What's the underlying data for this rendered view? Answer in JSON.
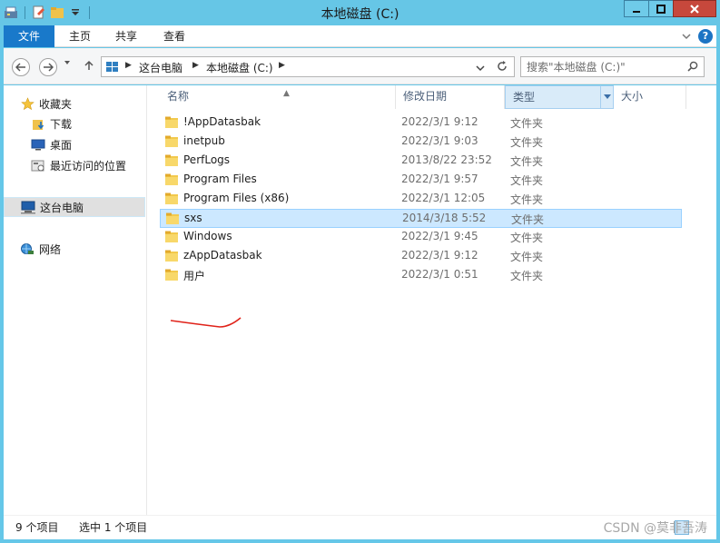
{
  "window": {
    "title": "本地磁盘 (C:)",
    "accent_color": "#1979ca",
    "frame_color": "#65c7e8"
  },
  "ribbon": {
    "tabs": [
      "文件",
      "主页",
      "共享",
      "查看"
    ]
  },
  "address": {
    "crumbs": [
      "这台电脑",
      "本地磁盘 (C:)"
    ]
  },
  "search": {
    "placeholder": "搜索\"本地磁盘 (C:)\""
  },
  "navpane": {
    "items": [
      {
        "label": "收藏夹",
        "icon": "star-icon"
      },
      {
        "label": "下载",
        "icon": "download-folder-icon"
      },
      {
        "label": "桌面",
        "icon": "desktop-icon"
      },
      {
        "label": "最近访问的位置",
        "icon": "recent-places-icon"
      },
      {
        "label": "这台电脑",
        "icon": "computer-icon"
      },
      {
        "label": "网络",
        "icon": "network-icon"
      }
    ]
  },
  "columns": {
    "name": "名称",
    "date": "修改日期",
    "type": "类型",
    "size": "大小"
  },
  "files": [
    {
      "name": "!AppDatasbak",
      "date": "2022/3/1 9:12",
      "type": "文件夹"
    },
    {
      "name": "inetpub",
      "date": "2022/3/1 9:03",
      "type": "文件夹"
    },
    {
      "name": "PerfLogs",
      "date": "2013/8/22 23:52",
      "type": "文件夹"
    },
    {
      "name": "Program Files",
      "date": "2022/3/1 9:57",
      "type": "文件夹"
    },
    {
      "name": "Program Files (x86)",
      "date": "2022/3/1 12:05",
      "type": "文件夹"
    },
    {
      "name": "sxs",
      "date": "2014/3/18 5:52",
      "type": "文件夹",
      "selected": true
    },
    {
      "name": "Windows",
      "date": "2022/3/1 9:45",
      "type": "文件夹"
    },
    {
      "name": "zAppDatasbak",
      "date": "2022/3/1 9:12",
      "type": "文件夹"
    },
    {
      "name": "用户",
      "date": "2022/3/1 0:51",
      "type": "文件夹"
    }
  ],
  "status": {
    "count": "9 个项目",
    "selection": "选中 1 个项目"
  },
  "watermark": "CSDN @莫非吾涛"
}
